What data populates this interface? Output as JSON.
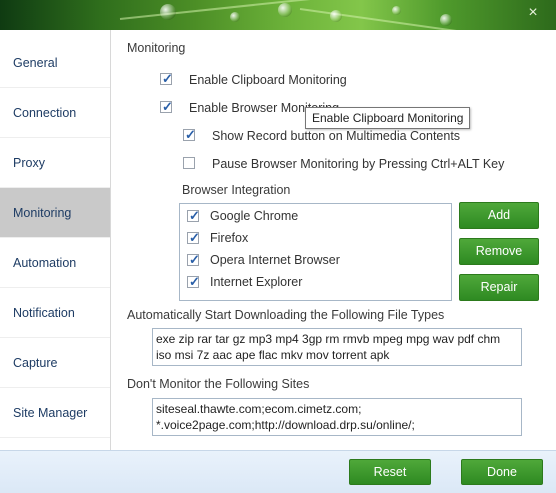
{
  "sidebar": {
    "items": [
      {
        "label": "General"
      },
      {
        "label": "Connection"
      },
      {
        "label": "Proxy"
      },
      {
        "label": "Monitoring",
        "active": true
      },
      {
        "label": "Automation"
      },
      {
        "label": "Notification"
      },
      {
        "label": "Capture"
      },
      {
        "label": "Site Manager"
      }
    ]
  },
  "monitoring": {
    "title": "Monitoring",
    "clipboard": {
      "label": "Enable Clipboard Monitoring",
      "checked": true
    },
    "browser": {
      "label": "Enable Browser Monitoring",
      "checked": true
    },
    "show_record": {
      "label": "Show Record button on Multimedia Contents",
      "checked": true
    },
    "pause": {
      "label": "Pause Browser Monitoring by Pressing Ctrl+ALT Key",
      "checked": false
    },
    "integration_title": "Browser Integration",
    "browsers": [
      {
        "label": "Google Chrome",
        "checked": true
      },
      {
        "label": "Firefox",
        "checked": true
      },
      {
        "label": "Opera Internet Browser",
        "checked": true
      },
      {
        "label": "Internet Explorer",
        "checked": true
      }
    ],
    "buttons": {
      "add": "Add",
      "remove": "Remove",
      "repair": "Repair"
    },
    "auto_title": "Automatically Start Downloading the Following File Types",
    "file_types": "exe zip rar tar gz mp3 mp4 3gp rm rmvb mpeg mpg wav pdf chm iso msi 7z aac ape flac mkv mov torrent apk",
    "exclude_title": "Don't Monitor the Following Sites",
    "sites": "siteseal.thawte.com;ecom.cimetz.com;\n*.voice2page.com;http://download.drp.su/online/;"
  },
  "tooltip": "Enable Clipboard Monitoring",
  "footer": {
    "reset": "Reset",
    "done": "Done"
  },
  "window": {
    "close_glyph": "×"
  },
  "colors": {
    "accent_green": "#3a9a2c",
    "sidebar_active": "#c9c9c9",
    "label_blue": "#1e3c64"
  }
}
